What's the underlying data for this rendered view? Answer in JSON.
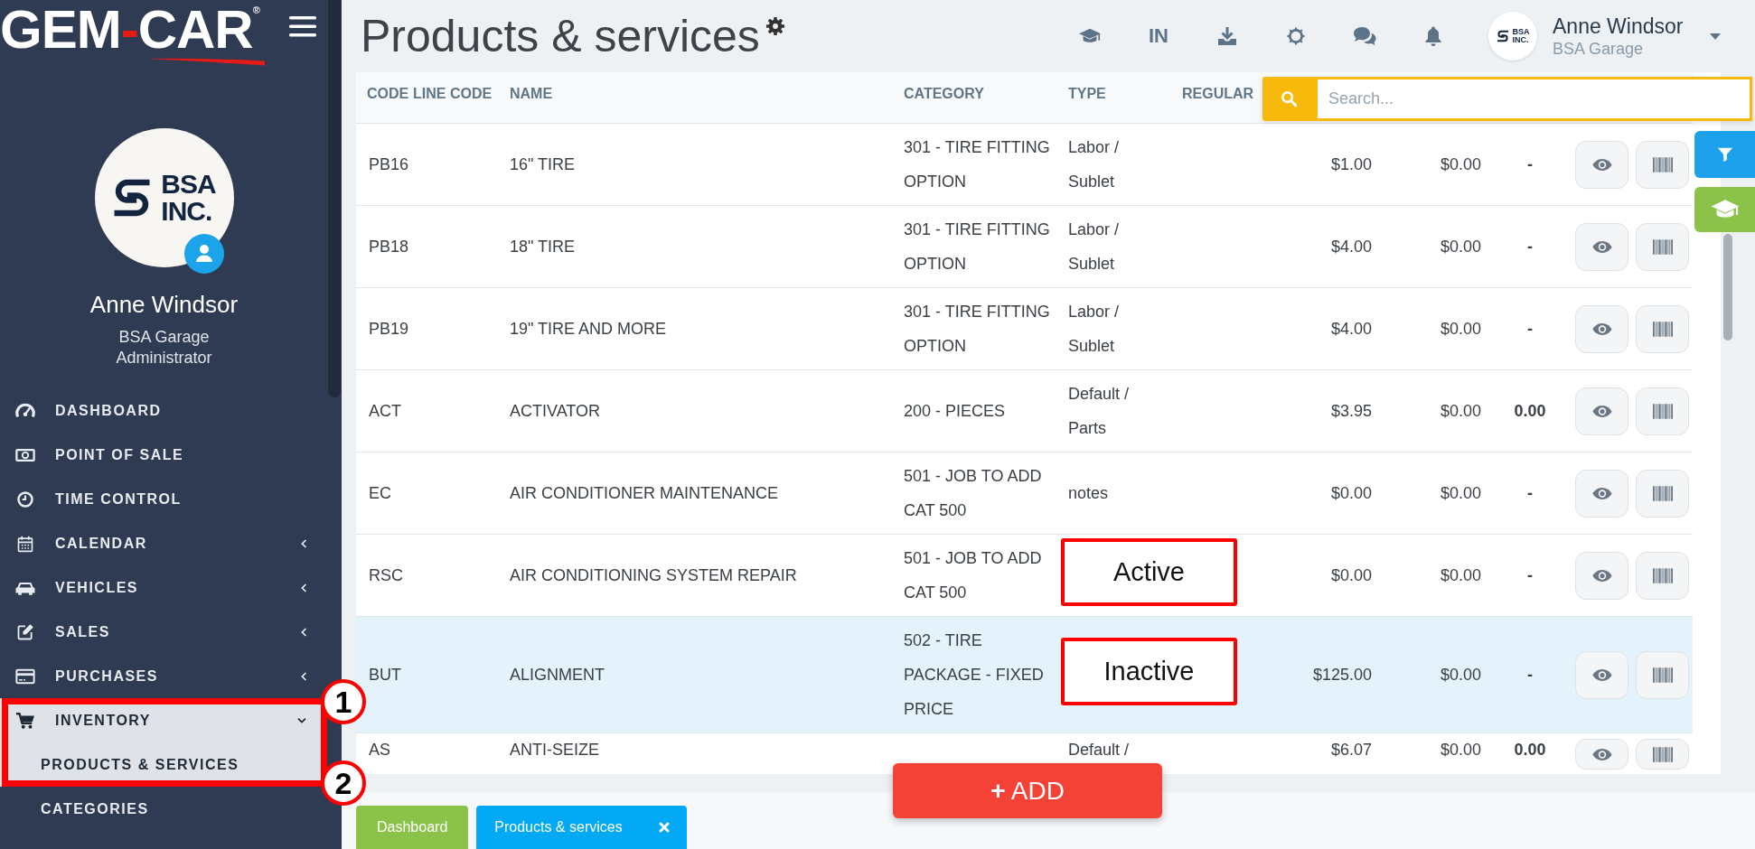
{
  "sidebar": {
    "logo": {
      "parts": [
        {
          "text": "GEM",
          "accent": false
        },
        {
          "text": "-",
          "accent": true
        },
        {
          "text": "CAR",
          "accent": false
        }
      ],
      "mark": "®"
    },
    "profile": {
      "logo_lines": [
        "BSA",
        "INC."
      ],
      "name": "Anne Windsor",
      "company": "BSA Garage",
      "role": "Administrator"
    },
    "menu": [
      {
        "label": "DASHBOARD",
        "submenu": false,
        "expanded": false,
        "annotated": false
      },
      {
        "label": "POINT OF SALE",
        "submenu": false,
        "expanded": false,
        "annotated": false
      },
      {
        "label": "TIME CONTROL",
        "submenu": false,
        "expanded": false,
        "annotated": false
      },
      {
        "label": "CALENDAR",
        "submenu": true,
        "expanded": false,
        "annotated": false
      },
      {
        "label": "VEHICLES",
        "submenu": true,
        "expanded": false,
        "annotated": false
      },
      {
        "label": "SALES",
        "submenu": true,
        "expanded": false,
        "annotated": false
      },
      {
        "label": "PURCHASES",
        "submenu": true,
        "expanded": false,
        "annotated": false
      },
      {
        "label": "INVENTORY",
        "submenu": true,
        "expanded": true,
        "annotated": true,
        "marker": "1",
        "children": [
          {
            "label": "PRODUCTS & SERVICES",
            "selected": true,
            "marker": "2"
          },
          {
            "label": "CATEGORIES",
            "selected": false
          }
        ]
      }
    ]
  },
  "header": {
    "title": "Products & services",
    "language": "IN",
    "user": {
      "logo_lines": [
        "BSA",
        "INC."
      ],
      "name": "Anne Windsor",
      "company": "BSA Garage"
    }
  },
  "search": {
    "placeholder": "Search..."
  },
  "table": {
    "columns": [
      "CODE",
      "LINE CODE",
      "NAME",
      "CATEGORY",
      "TYPE",
      "REGULAR"
    ],
    "rows": [
      {
        "code": "PB16",
        "name": "16\" TIRE",
        "category": "301 - TIRE FITTING OPTION",
        "type": "Labor / Sublet",
        "regular": "$1.00",
        "column_7": "$0.00",
        "column_8": "-",
        "selected": false
      },
      {
        "code": "PB18",
        "name": "18\" TIRE",
        "category": "301 - TIRE FITTING OPTION",
        "type": "Labor / Sublet",
        "regular": "$4.00",
        "column_7": "$0.00",
        "column_8": "-",
        "selected": false
      },
      {
        "code": "PB19",
        "name": "19\" TIRE AND MORE",
        "category": "301 - TIRE FITTING OPTION",
        "type": "Labor / Sublet",
        "regular": "$4.00",
        "column_7": "$0.00",
        "column_8": "-",
        "selected": false
      },
      {
        "code": "ACT",
        "name": "ACTIVATOR",
        "category": "200 - PIECES",
        "type": "Default / Parts",
        "regular": "$3.95",
        "column_7": "$0.00",
        "column_8": "0.00",
        "selected": false
      },
      {
        "code": "EC",
        "name": "AIR CONDITIONER MAINTENANCE",
        "category": "501 - JOB TO ADD CAT 500",
        "type": "notes",
        "regular": "$0.00",
        "column_7": "$0.00",
        "column_8": "-",
        "selected": false
      },
      {
        "code": "RSC",
        "name": "AIR CONDITIONING SYSTEM REPAIR",
        "category": "501 - JOB TO ADD CAT 500",
        "callout": "Active",
        "regular": "$0.00",
        "column_7": "$0.00",
        "column_8": "-",
        "selected": false
      },
      {
        "code": "BUT",
        "name": "ALIGNMENT",
        "category": "502 - TIRE PACKAGE - FIXED PRICE",
        "callout": "Inactive",
        "regular": "$125.00",
        "column_7": "$0.00",
        "column_8": "-",
        "selected": true
      },
      {
        "code": "AS",
        "name": "ANTI-SEIZE",
        "type": "Default /",
        "regular": "$6.07",
        "column_7": "$0.00",
        "column_8": "0.00",
        "selected": false
      }
    ]
  },
  "add_button": {
    "label": "**+** ADD"
  },
  "page_tabs": [
    {
      "label": "Dashboard",
      "selected": false,
      "closable": false
    },
    {
      "label": "Products & services",
      "selected": true,
      "closable": true
    }
  ]
}
